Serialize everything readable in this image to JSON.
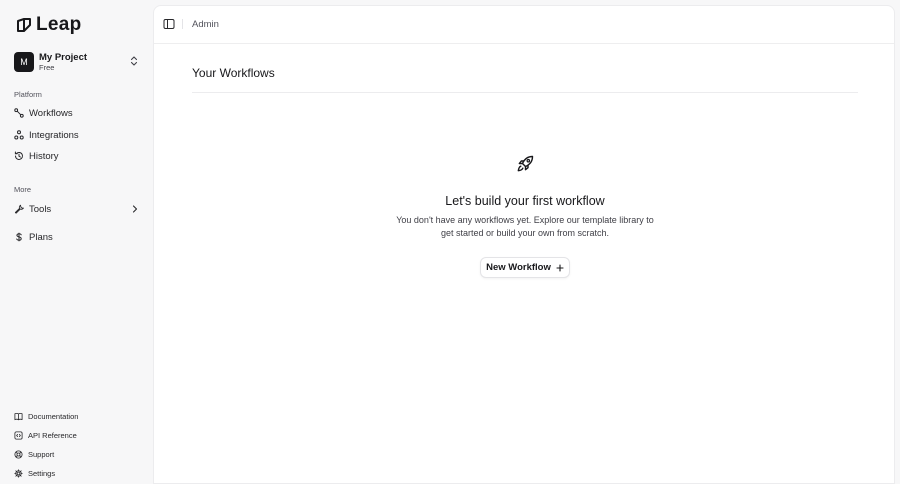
{
  "brand": {
    "name": "Leap"
  },
  "project": {
    "avatar_letter": "M",
    "name": "My Project",
    "plan": "Free"
  },
  "sidebar": {
    "platform_label": "Platform",
    "platform_items": [
      {
        "label": "Workflows",
        "icon": "workflow-icon"
      },
      {
        "label": "Integrations",
        "icon": "integrations-icon"
      },
      {
        "label": "History",
        "icon": "history-icon"
      }
    ],
    "more_label": "More",
    "more_items": [
      {
        "label": "Tools",
        "icon": "wrench-icon"
      },
      {
        "label": "Plans",
        "icon": "dollar-icon"
      }
    ],
    "footer_items": [
      {
        "label": "Documentation",
        "icon": "book-icon"
      },
      {
        "label": "API Reference",
        "icon": "code-icon"
      },
      {
        "label": "Support",
        "icon": "lifebuoy-icon"
      },
      {
        "label": "Settings",
        "icon": "gear-icon"
      }
    ]
  },
  "header": {
    "breadcrumb": "Admin"
  },
  "main": {
    "title": "Your Workflows",
    "empty_state": {
      "icon": "rocket-icon",
      "heading": "Let's build your first workflow",
      "description": "You don't have any workflows yet. Explore our template library to get started or build your own from scratch.",
      "button_label": "New Workflow"
    }
  }
}
